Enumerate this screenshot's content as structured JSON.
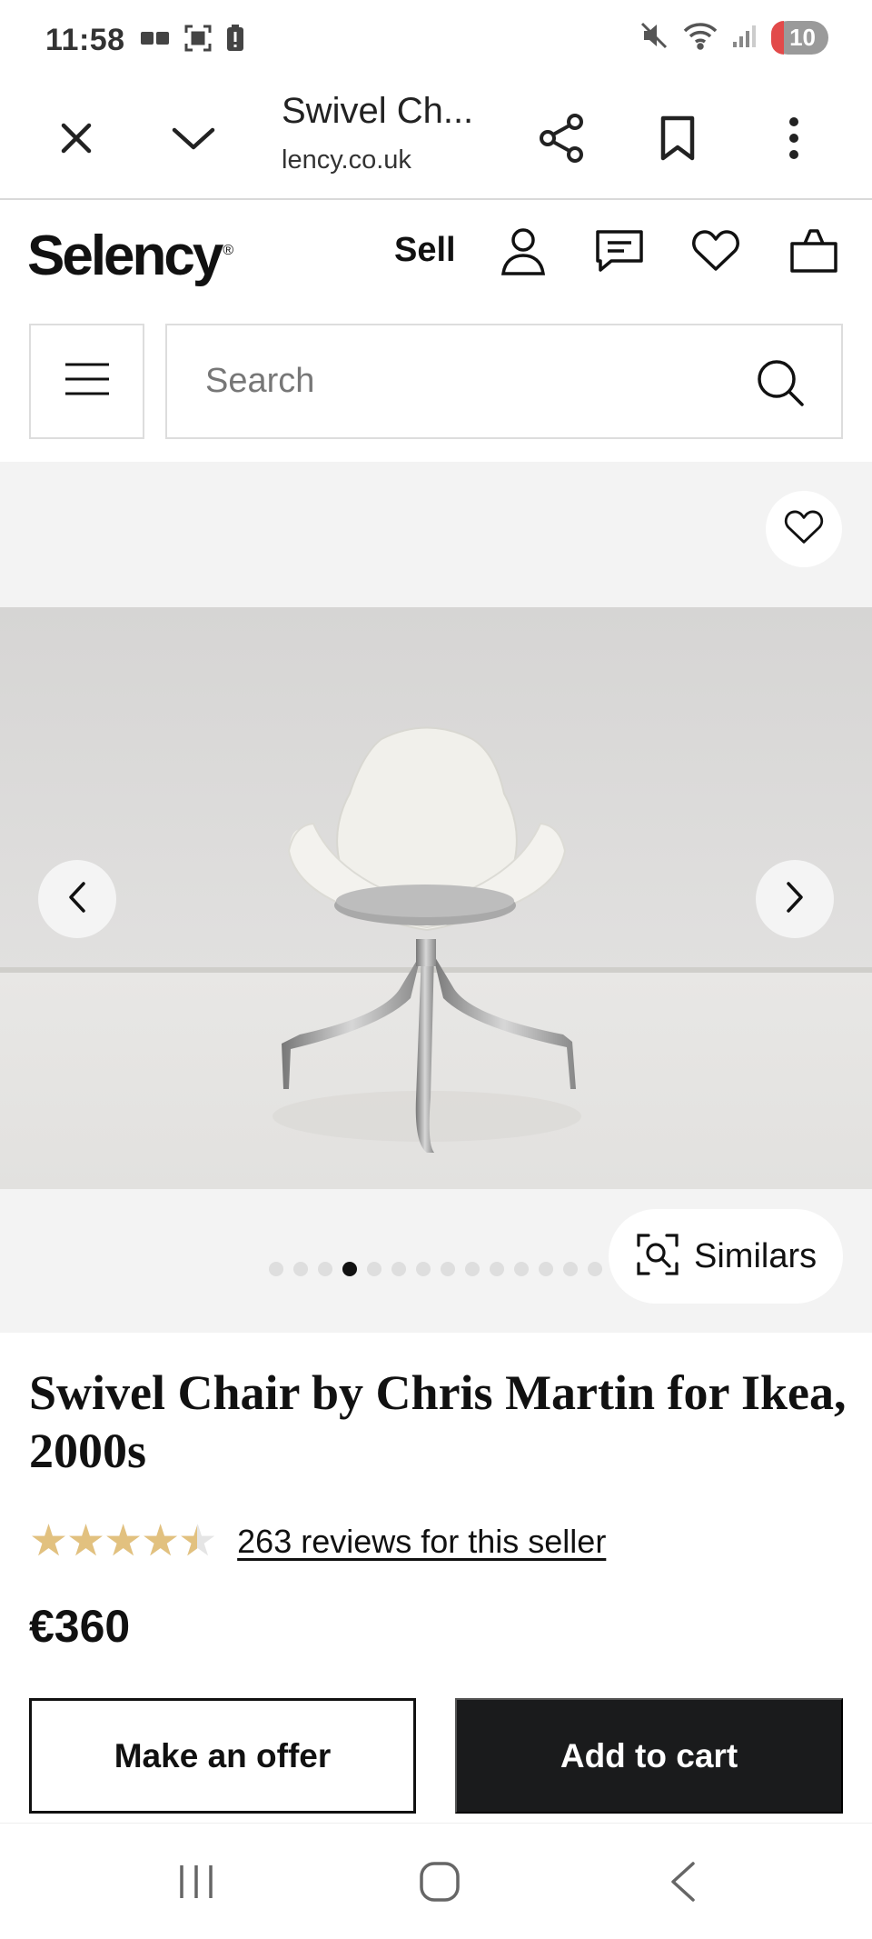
{
  "status_bar": {
    "time": "11:58",
    "battery_level": "10",
    "left_icons": [
      "notification-icon",
      "screenshot-icon",
      "battery-alert-icon"
    ],
    "right_icons": [
      "mute-icon",
      "wifi-icon",
      "signal-icon"
    ]
  },
  "browser": {
    "tab_title": "Swivel Ch...",
    "url": "lency.co.uk",
    "close_icon": "close-icon",
    "collapse_icon": "chevron-down-icon",
    "share_icon": "share-icon",
    "bookmark_icon": "bookmark-icon",
    "menu_icon": "more-vertical-icon"
  },
  "site_header": {
    "logo": "Selency",
    "logo_mark": "®",
    "sell_label": "Sell",
    "icons": [
      "account-icon",
      "messages-icon",
      "favorites-icon",
      "cart-icon"
    ]
  },
  "search": {
    "placeholder": "Search",
    "menu_icon": "hamburger-menu-icon",
    "search_icon": "search-icon"
  },
  "gallery": {
    "image_count": 14,
    "current_index": 4,
    "similars_label": "Similars",
    "favorite_icon": "heart-icon",
    "prev_icon": "chevron-left-icon",
    "next_icon": "chevron-right-icon"
  },
  "product": {
    "title": "Swivel Chair by Chris Martin for Ikea, 2000s",
    "rating": 4.5,
    "rating_max": 5,
    "reviews_label": "263 reviews for this seller",
    "price": "€360",
    "offer_label": "Make an offer",
    "cart_label": "Add to cart"
  },
  "colors": {
    "star": "#e2c17f",
    "cart_button": "#1a1b1c",
    "gallery_bg": "#f3f3f3"
  },
  "system_nav": {
    "icons": [
      "recent-apps-icon",
      "home-icon",
      "back-icon"
    ]
  }
}
